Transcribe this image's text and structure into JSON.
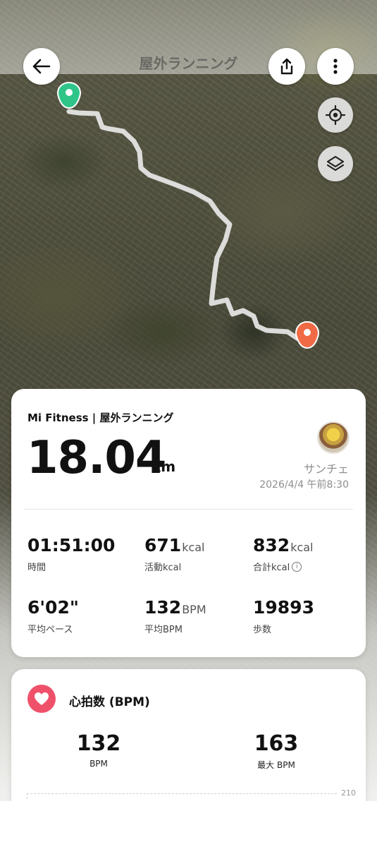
{
  "map": {
    "title": "屋外ランニング",
    "back_icon": "arrow-left-icon",
    "share_icon": "share-icon",
    "more_icon": "more-vertical-icon",
    "locate_icon": "locate-icon",
    "layers_icon": "layers-icon",
    "start_marker_color": "#2fc589",
    "end_marker_color": "#f06a45"
  },
  "summary": {
    "brand": "Mi Fitness | 屋外ランニング",
    "distance": "18.04",
    "distance_unit": "km",
    "username": "サンチェ",
    "date": "2026/4/4 午前8:30",
    "stats": [
      {
        "value": "01:51:00",
        "unit": "",
        "label": "時間"
      },
      {
        "value": "671",
        "unit": "kcal",
        "label": "活動kcal"
      },
      {
        "value": "832",
        "unit": "kcal",
        "label": "合計kcal"
      },
      {
        "value": "6'02\"",
        "unit": "",
        "label": "平均ペース"
      },
      {
        "value": "132",
        "unit": "BPM",
        "label": "平均BPM"
      },
      {
        "value": "19893",
        "unit": "",
        "label": "歩数"
      }
    ]
  },
  "heart": {
    "title": "心拍数 (BPM)",
    "icon": "heart-icon",
    "accent": "#f0516a",
    "avg_value": "132",
    "avg_label": "BPM",
    "max_value": "163",
    "max_label": "最大 BPM",
    "chart_top_label": "210"
  }
}
